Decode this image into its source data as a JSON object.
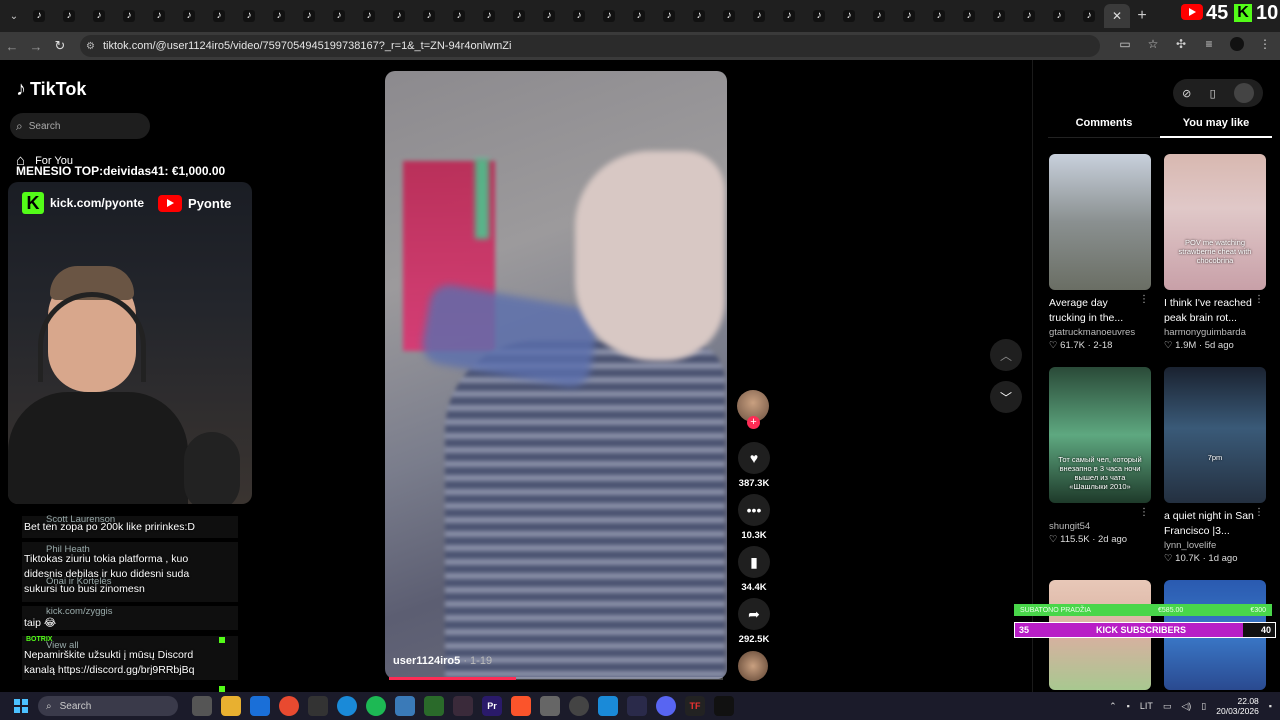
{
  "browser": {
    "tabs_count": 36,
    "new_tab_label": "+",
    "close_label": "✕",
    "url": "tiktok.com/@user1124iro5/video/7597054945199738167?_r=1&_t=ZN-94r4onlwmZi"
  },
  "overlay": {
    "yt_count": "45",
    "kick_count": "10",
    "menesio": "MENESIO TOP:deividas41: €1,000.00",
    "kick_url": "kick.com/pyonte",
    "yt_name": "Pyonte"
  },
  "tiktok": {
    "logo": "TikTok",
    "search_placeholder": "Search",
    "for_you": "For You"
  },
  "chat": [
    {
      "user": "Scott Laurenson",
      "text": "Bet ten zopa po 200k like pririnkes:D"
    },
    {
      "user": "Phil Heath",
      "text": "Tiktokas ziuriu tokia platforma , kuo didesnis debilas ir kuo didesni suda sukursi tuo busi zinomesn"
    },
    {
      "user": "Onai ir Kortelės",
      "text": ""
    },
    {
      "user": "kick.com/zyggis",
      "text": "taip 😂"
    },
    {
      "user": "BOTRIX",
      "text": "Nepamirškite užsukti į mūsų Discord kanalą https://discord.gg/brj9RRbjBq"
    },
    {
      "user": "View all",
      "text": ""
    }
  ],
  "video": {
    "author": "user1124iro5",
    "date": " · 1-19",
    "progress": 0.38,
    "likes": "387.3K",
    "comments": "10.3K",
    "saves": "34.4K",
    "shares": "292.5K"
  },
  "panel": {
    "tab_comments": "Comments",
    "tab_you_may_like": "You may like",
    "cards": [
      {
        "title": "Average day trucking in the...",
        "author": "gtatruckmanoeuvres",
        "stats": "♡ 61.7K · 2-18",
        "caption": ""
      },
      {
        "title": "I think I've reached peak brain rot...",
        "author": "harmonyguimbarda",
        "stats": "♡ 1.9M · 5d ago",
        "caption": "POV me watching strawberrie cheat with chocobrina"
      },
      {
        "title": "",
        "author": "shungit54",
        "stats": "♡ 115.5K · 2d ago",
        "caption": "Тот самый чел, который внезапно в 3 часа ночи вышел из чата «Шашлыки 2010»"
      },
      {
        "title": "a quiet night in San Francisco |3...",
        "author": "lynn_lovelife",
        "stats": "♡ 10.7K · 1d ago",
        "caption": "7pm"
      }
    ]
  },
  "subs": {
    "top_left": "SUBATONO PRADŽIA",
    "top_mid": "€585.00",
    "top_right": "€300",
    "left": "35",
    "label": "KICK SUBSCRIBERS",
    "right": "40"
  },
  "taskbar": {
    "search_placeholder": "Search",
    "lang": "LIT",
    "time": "22.08",
    "date": "20/03/2026"
  },
  "colors": {
    "accent": "#fe2c55",
    "kick": "#53fc18",
    "youtube": "#ff0000"
  }
}
